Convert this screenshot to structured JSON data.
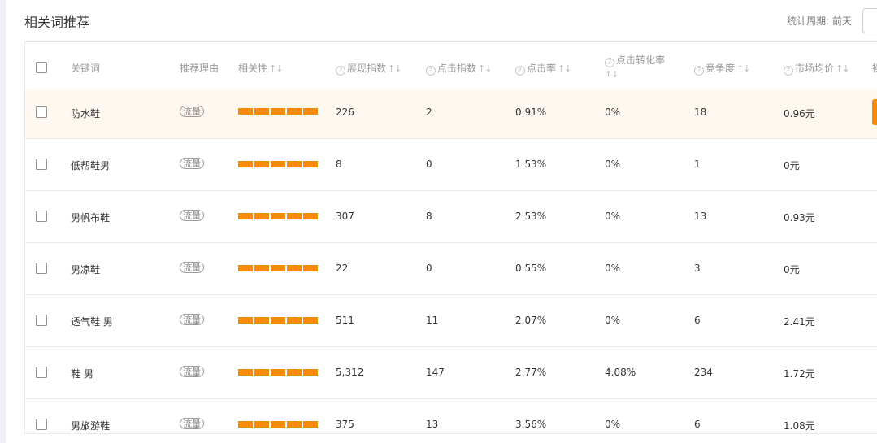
{
  "header": {
    "title": "相关词推荐",
    "period_label": "统计周期:",
    "period_value": "前天"
  },
  "columns": {
    "keyword": "关键词",
    "reason": "推荐理由",
    "relevance": "相关性",
    "impressions": "展现指数",
    "clicks": "点击指数",
    "ctr": "点击率",
    "conv_line1": "点击转化率",
    "competition": "竞争度",
    "price": "市场均价",
    "action_partial": "操"
  },
  "sort_icon": "↑↓",
  "help_icon": "?",
  "rows": [
    {
      "keyword": "防水鞋",
      "reason": "流量",
      "relevance": 5,
      "impressions": "226",
      "clicks": "2",
      "ctr": "0.91%",
      "conv": "0%",
      "competition": "18",
      "price": "0.96元"
    },
    {
      "keyword": "低帮鞋男",
      "reason": "流量",
      "relevance": 5,
      "impressions": "8",
      "clicks": "0",
      "ctr": "1.53%",
      "conv": "0%",
      "competition": "1",
      "price": "0元"
    },
    {
      "keyword": "男帆布鞋",
      "reason": "流量",
      "relevance": 5,
      "impressions": "307",
      "clicks": "8",
      "ctr": "2.53%",
      "conv": "0%",
      "competition": "13",
      "price": "0.93元"
    },
    {
      "keyword": "男凉鞋",
      "reason": "流量",
      "relevance": 5,
      "impressions": "22",
      "clicks": "0",
      "ctr": "0.55%",
      "conv": "0%",
      "competition": "3",
      "price": "0元"
    },
    {
      "keyword": "透气鞋 男",
      "reason": "流量",
      "relevance": 5,
      "impressions": "511",
      "clicks": "11",
      "ctr": "2.07%",
      "conv": "0%",
      "competition": "6",
      "price": "2.41元"
    },
    {
      "keyword": "鞋 男",
      "reason": "流量",
      "relevance": 5,
      "impressions": "5,312",
      "clicks": "147",
      "ctr": "2.77%",
      "conv": "4.08%",
      "competition": "234",
      "price": "1.72元"
    },
    {
      "keyword": "男旅游鞋",
      "reason": "流量",
      "relevance": 5,
      "impressions": "375",
      "clicks": "13",
      "ctr": "3.56%",
      "conv": "0%",
      "competition": "6",
      "price": "1.08元"
    }
  ],
  "colors": {
    "accent_orange": "#f58a07",
    "highlight_row": "#fff8f1"
  }
}
